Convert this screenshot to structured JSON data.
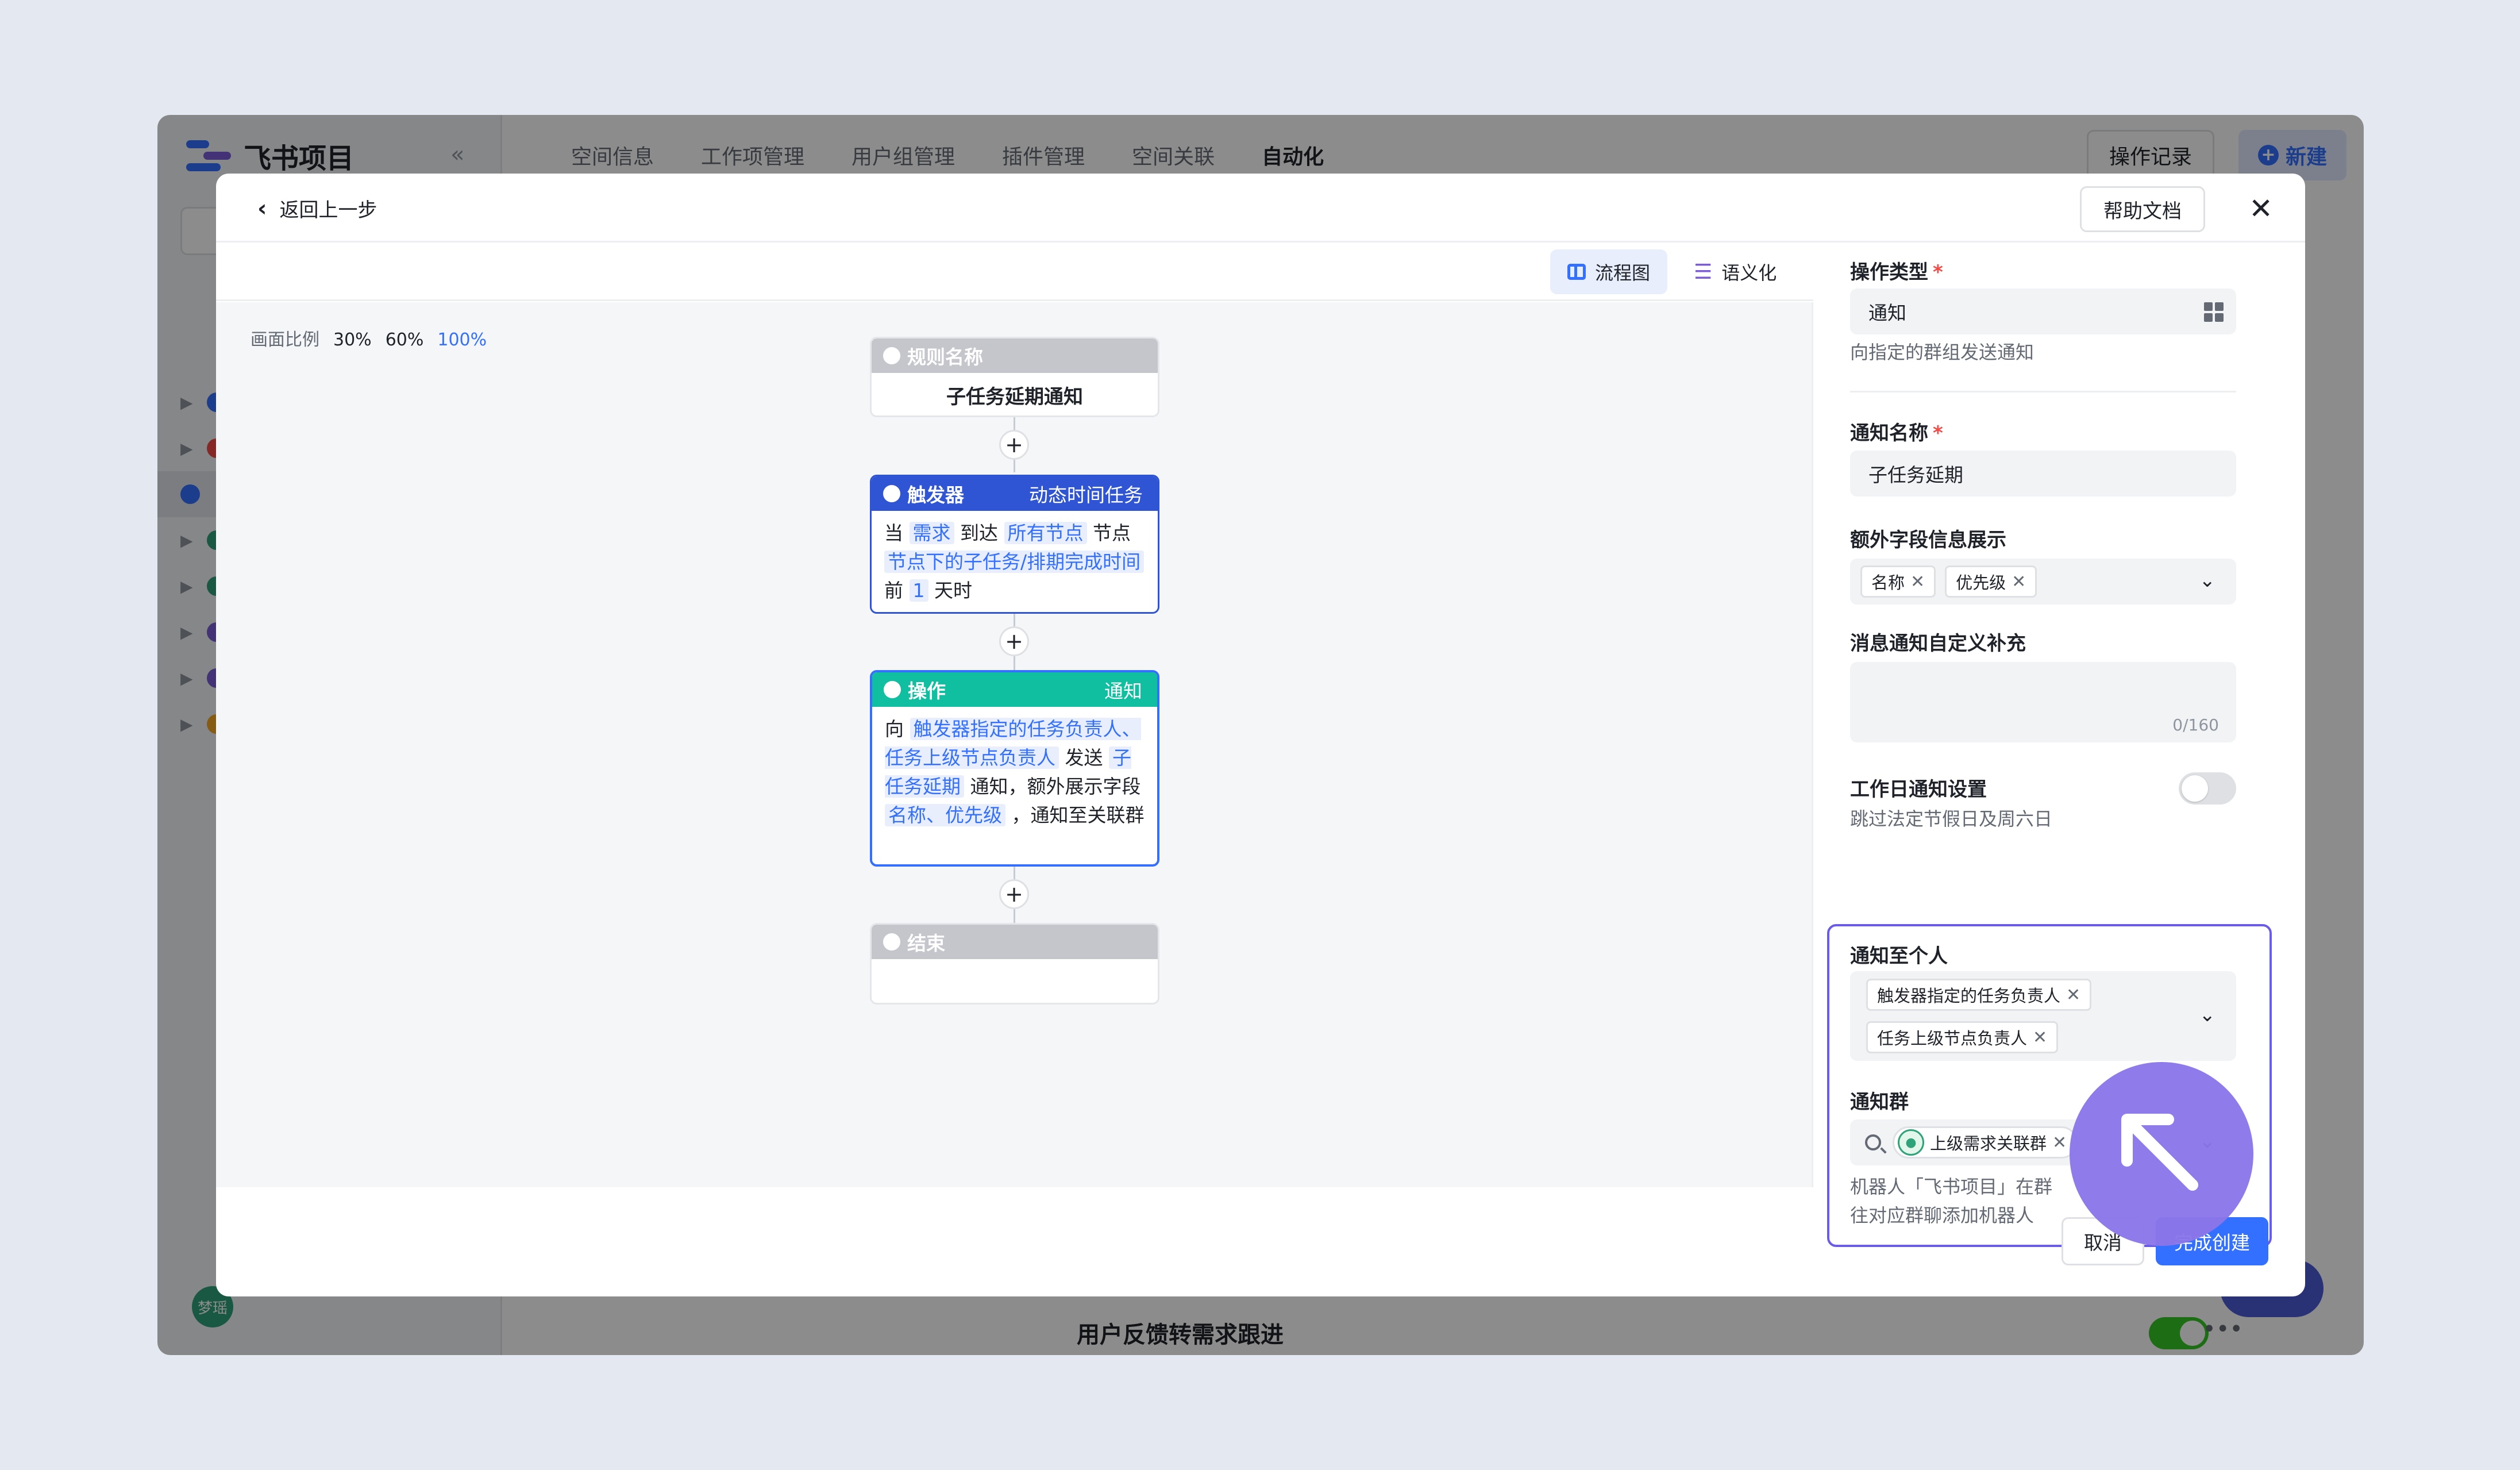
{
  "app": {
    "brand": "飞书项目",
    "tabs": [
      "空间信息",
      "工作项管理",
      "用户组管理",
      "插件管理",
      "空间关联",
      "自动化"
    ],
    "active_tab": 5,
    "op_log": "操作记录",
    "new_btn": "新建",
    "avatar_text": "梦瑶",
    "bottom_rule": "用户反馈转需求跟进"
  },
  "modal": {
    "back": "返回上一步",
    "help_doc": "帮助文档",
    "close": "✕"
  },
  "canvas": {
    "views": {
      "flow": "流程图",
      "semantic": "语义化"
    },
    "zoom_label": "画面比例",
    "zoom_options": [
      "30%",
      "60%",
      "100%"
    ]
  },
  "nodes": {
    "rule": {
      "head": "规则名称",
      "title": "子任务延期通知"
    },
    "trigger": {
      "head": "触发器",
      "sub": "动态时间任务",
      "w1": "当",
      "v1": "需求",
      "w2": "到达",
      "v2": "所有节点",
      "w3": "节点",
      "v3": "节点下的子任务/排期完成时间",
      "w4": "前",
      "v4": "1",
      "w5": "天时"
    },
    "action": {
      "head": "操作",
      "sub": "通知",
      "w1": "向",
      "v1": "触发器指定的任务负责人、任务上级节点负责人",
      "w2": "发送",
      "v2": "子任务延期",
      "w3": "通知，额外展示字段",
      "v3": "名称、优先级",
      "w4": "，通知至关联群"
    },
    "end": {
      "head": "结束"
    }
  },
  "panel": {
    "op_type": {
      "label": "操作类型",
      "value": "通知",
      "hint": "向指定的群组发送通知"
    },
    "notify_name": {
      "label": "通知名称",
      "value": "子任务延期"
    },
    "extra_fields": {
      "label": "额外字段信息展示",
      "tags": [
        "名称",
        "优先级"
      ]
    },
    "custom_msg": {
      "label": "消息通知自定义补充",
      "counter": "0/160"
    },
    "workday": {
      "label": "工作日通知设置",
      "hint": "跳过法定节假日及周六日"
    },
    "notify_person": {
      "label": "通知至个人",
      "tags": [
        "触发器指定的任务负责人",
        "任务上级节点负责人"
      ]
    },
    "notify_group": {
      "label": "通知群",
      "tag": "上级需求关联群",
      "hint_line1": "机器人「飞书项目」在群",
      "hint_line2": "往对应群聊添加机器人"
    },
    "required_mark": "*"
  },
  "footer": {
    "cancel": "取消",
    "create": "完成创建"
  }
}
